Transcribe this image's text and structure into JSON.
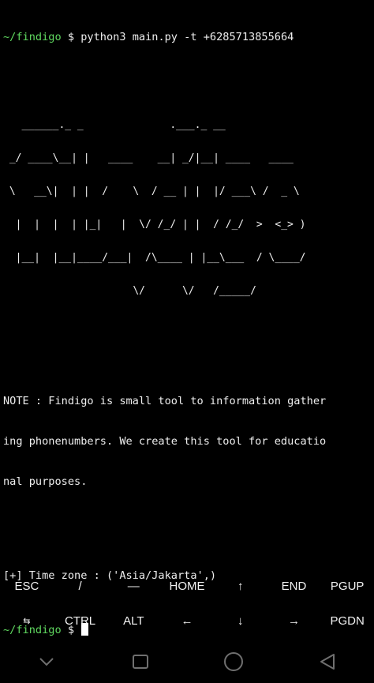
{
  "terminal": {
    "prompt_path": "~/findigo",
    "prompt_symbol": "$",
    "command": "python3 main.py -t +6285713855664",
    "banner": [
      "   ______._ _              .___._ __",
      " _/ ____\\__| |   ____    __| _/|__| ____   ____",
      " \\   __\\|  | |  /    \\  / __ | |  |/ ___\\ /  _ \\",
      "  |  |  |  | |_|   |  \\/ /_/ | |  / /_/  >  <_> )",
      "  |__|  |__|____/___|  /\\____ | |__\\___  / \\____/",
      "                     \\/      \\/   /_____/"
    ],
    "note_lines": [
      "NOTE : Findigo is small tool to information gather",
      "ing phonenumbers. We create this tool for educatio",
      "nal purposes."
    ],
    "timezone_line": "[+] Time zone : ('Asia/Jakarta',)",
    "final_prompt_path": "~/findigo",
    "final_prompt_symbol": "$"
  },
  "extra_keys": {
    "row1": [
      "ESC",
      "/",
      "—",
      "HOME",
      "↑",
      "END",
      "PGUP"
    ],
    "row2": [
      "⇆",
      "CTRL",
      "ALT",
      "←",
      "↓",
      "→",
      "PGDN"
    ]
  },
  "colors": {
    "background": "#000000",
    "prompt_green": "#5fd75f",
    "text": "#eeeeee",
    "nav_icon": "#6f6f6f"
  }
}
